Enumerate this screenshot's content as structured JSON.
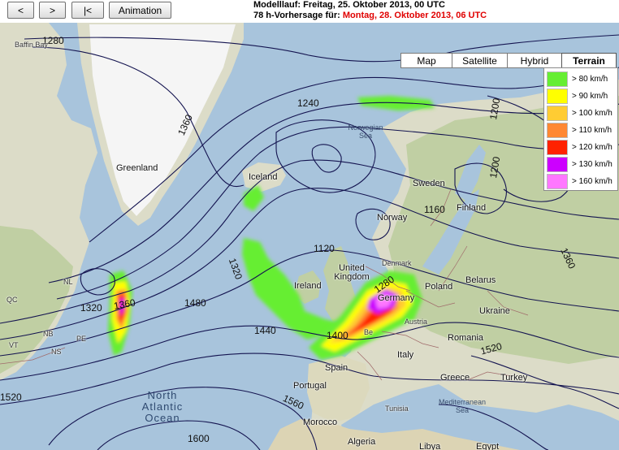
{
  "toolbar": {
    "prev_label": "<",
    "next_label": ">",
    "first_label": "|<",
    "animation_label": "Animation"
  },
  "header": {
    "model_run": "Modelllauf: Freitag, 25. Oktober 2013, 00 UTC",
    "forecast_prefix": "78 h-Vorhersage für:",
    "forecast_date": "Montag, 28. Oktober 2013, 06 UTC"
  },
  "map_type": {
    "options": [
      "Map",
      "Satellite",
      "Hybrid",
      "Terrain"
    ],
    "selected": "Terrain"
  },
  "legend": {
    "entries": [
      {
        "label": "> 80 km/h",
        "color": "#66ee33"
      },
      {
        "label": "> 90 km/h",
        "color": "#ffff00"
      },
      {
        "label": "> 100 km/h",
        "color": "#ffcc33"
      },
      {
        "label": "> 110 km/h",
        "color": "#ff8833"
      },
      {
        "label": "> 120 km/h",
        "color": "#ff2200"
      },
      {
        "label": "> 130 km/h",
        "color": "#cc00ff"
      },
      {
        "label": "> 160 km/h",
        "color": "#ff77ff"
      }
    ]
  },
  "places": {
    "baffin_bay": "Baffin Bay",
    "greenland": "Greenland",
    "iceland": "Iceland",
    "norwegian_sea": "Norwegian Sea",
    "sweden": "Sweden",
    "norway": "Norway",
    "finland": "Finland",
    "denmark": "Denmark",
    "united_kingdom": "United Kingdom",
    "ireland": "Ireland",
    "poland": "Poland",
    "belarus": "Belarus",
    "ukraine": "Ukraine",
    "germany": "Germany",
    "austria": "Austria",
    "romania": "Romania",
    "italy": "Italy",
    "spain": "Spain",
    "portugal": "Portugal",
    "greece": "Greece",
    "turkey": "Turkey",
    "tunisia": "Tunisia",
    "morocco": "Morocco",
    "algeria": "Algeria",
    "libya": "Libya",
    "egypt": "Egypt",
    "mediterranean_sea": "Mediterranean Sea",
    "north_atlantic_ocean": "North Atlantic Ocean",
    "qc": "QC",
    "nl": "NL",
    "nb": "NB",
    "pe": "PE",
    "vt": "VT",
    "ns": "NS",
    "be": "Be"
  },
  "isobar_labels": [
    "1280",
    "1280",
    "1360",
    "1240",
    "1200",
    "1200",
    "1160",
    "1120",
    "1320",
    "1320",
    "1360",
    "1480",
    "1440",
    "1400",
    "1280",
    "1360",
    "1520",
    "1560",
    "1600",
    "1520"
  ],
  "colors": {
    "ocean": "#a8c4dc",
    "land": "#dcdcc8",
    "vegetation": "#c0cfa3",
    "ice": "#f5f5f5",
    "isobar": "#141450"
  }
}
